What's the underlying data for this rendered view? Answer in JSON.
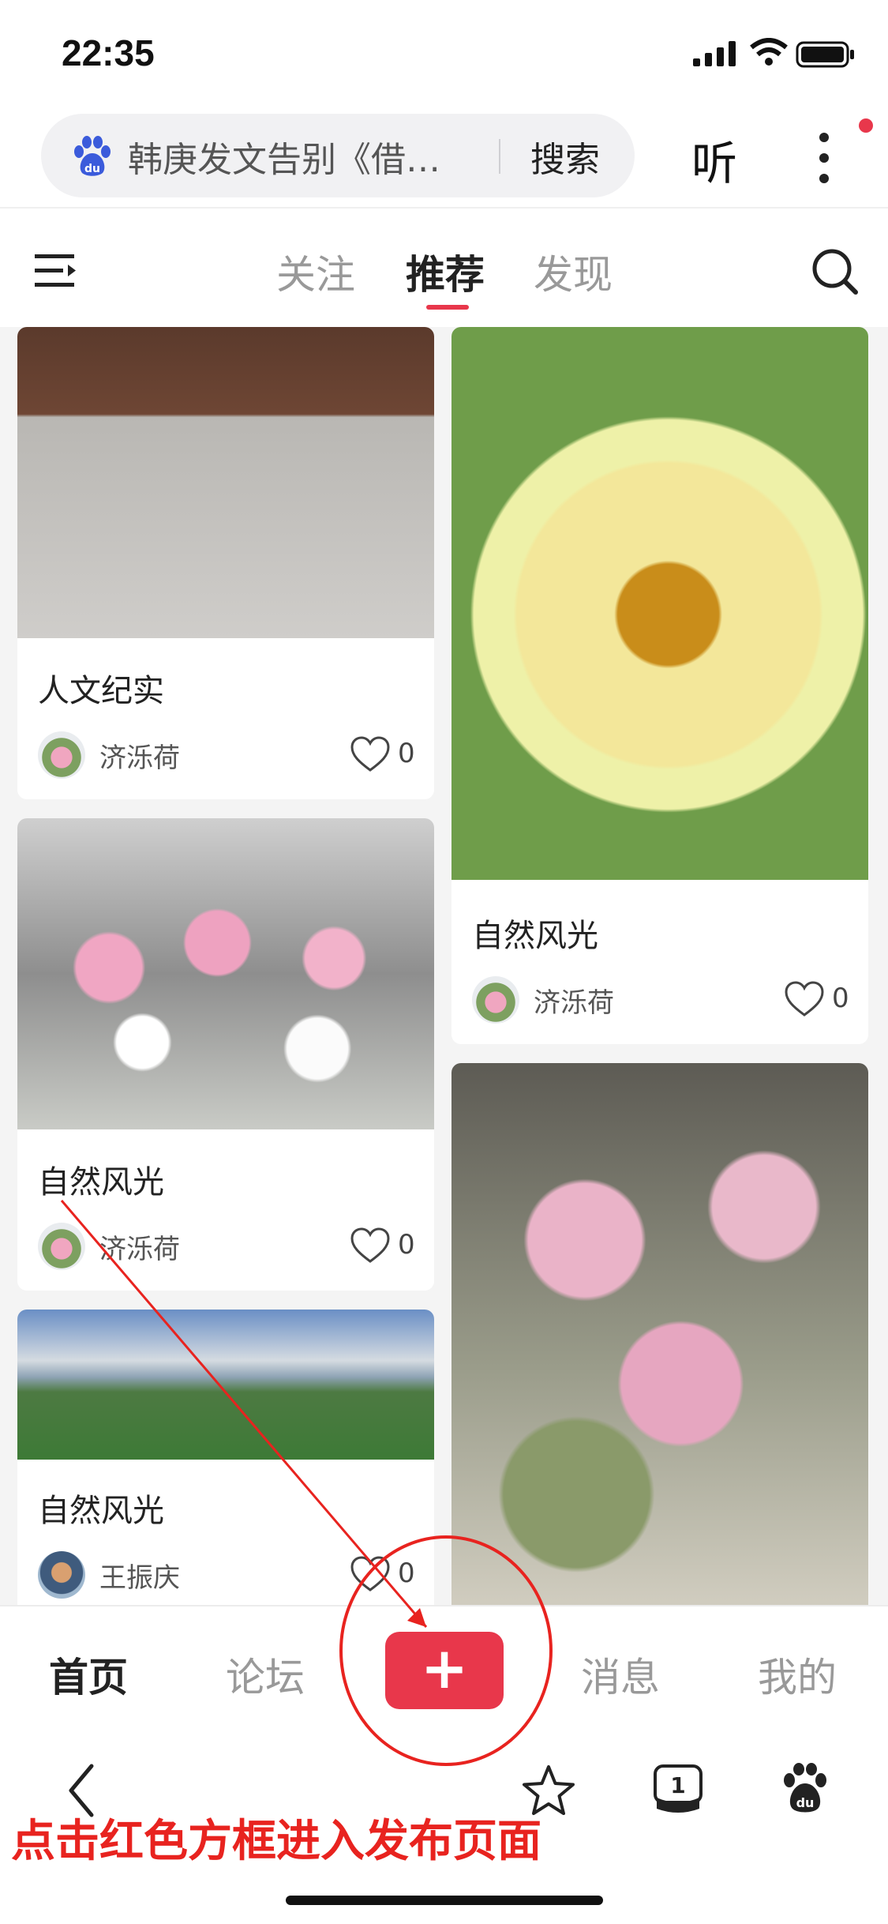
{
  "status_bar": {
    "time": "22:35"
  },
  "search": {
    "query": "韩庚发文告别《借…",
    "button": "搜索",
    "listen": "听"
  },
  "tabs": [
    {
      "label": "关注"
    },
    {
      "label": "推荐",
      "active": true
    },
    {
      "label": "发现"
    }
  ],
  "feed": {
    "left_column": [
      {
        "title": "人文纪实",
        "author": "济泺荷",
        "likes": "0"
      },
      {
        "title": "自然风光",
        "author": "济泺荷",
        "likes": "0"
      },
      {
        "title": "自然风光",
        "author": "王振庆",
        "likes": "0"
      }
    ],
    "right_column": [
      {
        "title": "自然风光",
        "author": "济泺荷",
        "likes": "0"
      },
      {
        "title": "",
        "author": "",
        "likes": ""
      }
    ]
  },
  "bottom_nav": [
    {
      "label": "首页",
      "active": true
    },
    {
      "label": "论坛"
    },
    {
      "label": "+"
    },
    {
      "label": "消息"
    },
    {
      "label": "我的"
    }
  ],
  "browser_toolbar": {
    "tab_count": "1"
  },
  "annotation": {
    "text": "点击红色方框进入发布页面"
  },
  "colors": {
    "accent": "#e8374b",
    "annotation": "#e8231f"
  },
  "icons": [
    "baidu-logo-icon",
    "menu-icon",
    "search-icon",
    "heart-icon",
    "back-icon",
    "star-icon",
    "tabs-icon",
    "baidu-paw-icon",
    "more-icon"
  ]
}
